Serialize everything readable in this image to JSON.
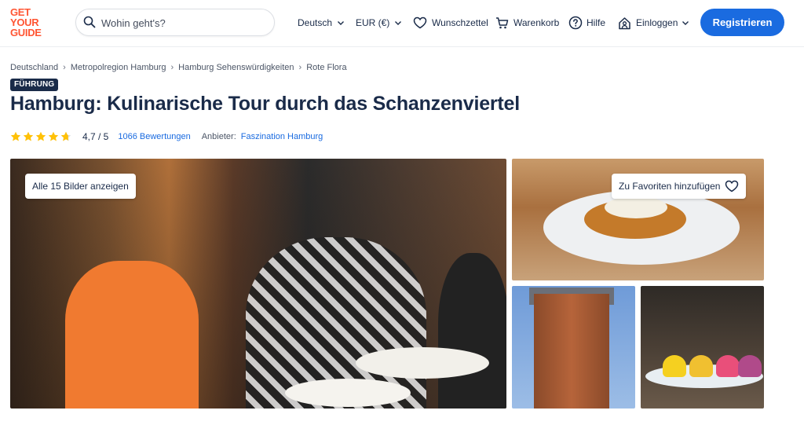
{
  "header": {
    "logo_lines": [
      "GET",
      "YOUR",
      "GUIDE"
    ],
    "search": {
      "placeholder": "Wohin geht's?",
      "value": ""
    },
    "language": "Deutsch",
    "currency": "EUR (€)",
    "wishlist": "Wunschzettel",
    "cart": "Warenkorb",
    "help": "Hilfe",
    "login": "Einloggen",
    "register": "Registrieren"
  },
  "breadcrumb": [
    "Deutschland",
    "Metropolregion Hamburg",
    "Hamburg Sehenswürdigkeiten",
    "Rote Flora"
  ],
  "badge": "FÜHRUNG",
  "title": "Hamburg: Kulinarische Tour durch das Schanzenviertel",
  "rating": {
    "stars": 4.7,
    "score_text": "4,7 / 5",
    "reviews_text": "1066 Bewertungen",
    "provider_label": "Anbieter:",
    "provider_name": "Faszination Hamburg"
  },
  "gallery": {
    "show_all_label": "Alle 15 Bilder anzeigen",
    "favorite_label": "Zu Favoriten hinzufügen"
  },
  "colors": {
    "brand": "#ff5533",
    "primary": "#1a6be0",
    "text": "#1a2b49",
    "star": "#ffc107"
  }
}
